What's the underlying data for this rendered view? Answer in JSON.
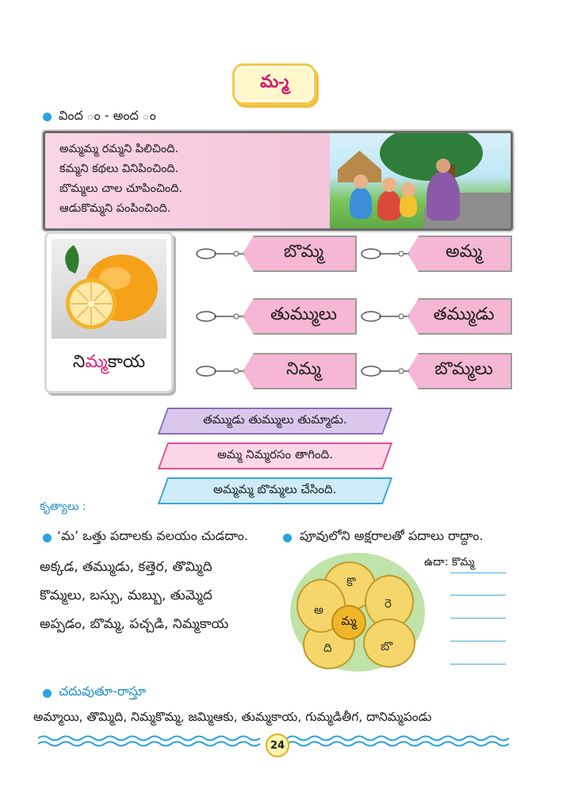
{
  "header": {
    "title": "మ-్మ"
  },
  "listen_section": {
    "label": "వింద ం - అంద ం"
  },
  "poem": {
    "lines": [
      "అమ్మమ్మ రమ్మని పిలిచింది.",
      "కమ్మని కథలు వినిపించింది.",
      "బొమ్మలు చాల చూపించింది.",
      "ఆడుకొమ్మని పంపించింది."
    ]
  },
  "lemon_card": {
    "label_before": "ని",
    "label_highlight": "మ్మ",
    "label_after": "కాయ"
  },
  "tags": [
    "బొమ్మ",
    "అమ్మ",
    "తుమ్ములు",
    "తమ్ముడు",
    "నిమ్మ",
    "బొమ్మలు"
  ],
  "sentences": [
    {
      "text": "తమ్ముడు తుమ్ములు తుమ్మాడు.",
      "fill": "#d9c8ec",
      "border": "#8a6fb8"
    },
    {
      "text": "అమ్మ నిమ్మరసం తాగింది.",
      "fill": "#fbd6e8",
      "border": "#e0508e"
    },
    {
      "text": "అమ్మమ్మ బొమ్మలు చేసింది.",
      "fill": "#cdebf8",
      "border": "#3aa3d8"
    }
  ],
  "activities": {
    "label": "కృత్యాలు :",
    "task1": "‘మ’ ఒత్తు పదాలకు వలయం చుడదాం.",
    "task2": "పూవులోని అక్షరాలతో పదాలు రాద్దాం.",
    "word_rows": [
      "అక్కడ, తమ్ముడు, కత్తెర, తొమ్మిది",
      "కొమ్మలు, బస్సు, మబ్బు, తుమ్మెద",
      "అప్పడం, బొమ్మ, పచ్చడి, నిమ్మకాయ"
    ],
    "example": "ఉదా: కొమ్మ",
    "flower": {
      "center": "మ్మ",
      "petals": [
        "కొ",
        "రె",
        "బొ",
        "ది",
        "అ"
      ]
    }
  },
  "read_write": {
    "label": "చదువుతూ-రాస్తూ",
    "words": "అమ్మాయి, తొమ్మిది, నిమ్మకొమ్మ, జమ్మిఆకు, తుమ్మకాయ, గుమ్మడితీగ, దానిమ్మపండు"
  },
  "footer": {
    "page_number": "24"
  },
  "colors": {
    "accent_pink": "#e0207a",
    "accent_cyan": "#1d8fcc",
    "tag_pink": "#f5b7d3"
  }
}
